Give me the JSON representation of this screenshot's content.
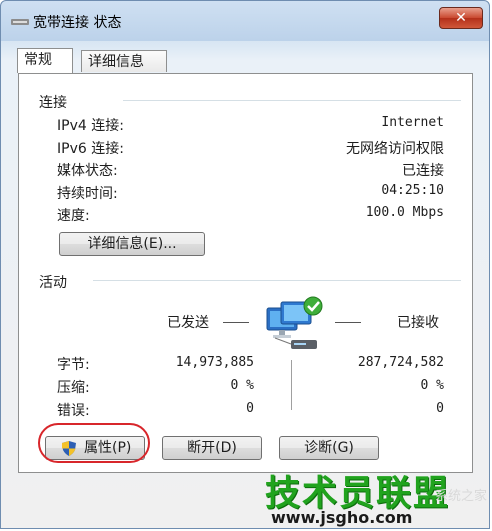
{
  "window": {
    "title": "宽带连接 状态",
    "close_label": "✕"
  },
  "tabs": [
    {
      "label": "常规",
      "active": true
    },
    {
      "label": "详细信息",
      "active": false
    }
  ],
  "connection": {
    "heading": "连接",
    "rows": [
      {
        "label": "IPv4 连接:",
        "value": "Internet"
      },
      {
        "label": "IPv6 连接:",
        "value": "无网络访问权限"
      },
      {
        "label": "媒体状态:",
        "value": "已连接"
      },
      {
        "label": "持续时间:",
        "value": "04:25:10"
      },
      {
        "label": "速度:",
        "value": "100.0 Mbps"
      }
    ],
    "details_button": "详细信息(E)..."
  },
  "activity": {
    "heading": "活动",
    "sent_label": "已发送",
    "received_label": "已接收",
    "rows": [
      {
        "label": "字节:",
        "sent": "14,973,885",
        "received": "287,724,582"
      },
      {
        "label": "压缩:",
        "sent": "0 %",
        "received": "0 %"
      },
      {
        "label": "错误:",
        "sent": "0",
        "received": "0"
      }
    ]
  },
  "buttons": {
    "properties": "属性(P)",
    "disconnect": "断开(D)",
    "diagnose": "诊断(G)"
  },
  "watermark": {
    "text": "技术员联盟",
    "url": "www.jsgho.com",
    "tag": "系统之家"
  },
  "colors": {
    "close": "#c9482f",
    "ring": "#d8262b",
    "watermark": "#21a31e"
  }
}
